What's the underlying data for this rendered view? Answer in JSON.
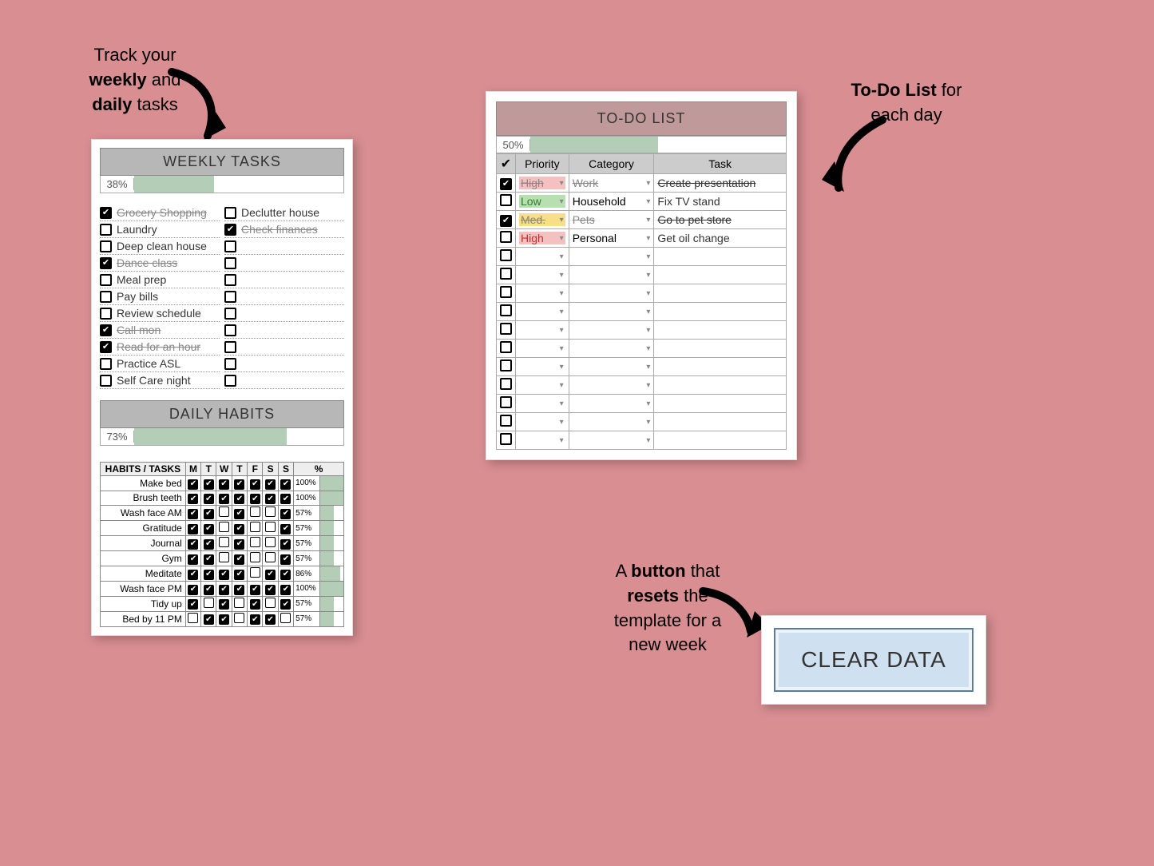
{
  "callouts": {
    "left1": "Track your",
    "left_b1": "weekly",
    "left_mid": " and ",
    "left_b2": "daily",
    "left2": " tasks",
    "right_b": "To-Do List",
    "right_tail": " for each day",
    "clear1": "A ",
    "clear_b1": "button",
    "clear2": " that ",
    "clear_b2": "resets",
    "clear3": " the template for a new week"
  },
  "weekly": {
    "title": "WEEKLY TASKS",
    "percent": "38%",
    "percent_num": 38,
    "left": [
      {
        "done": true,
        "label": "Grocery Shopping"
      },
      {
        "done": false,
        "label": "Laundry"
      },
      {
        "done": false,
        "label": "Deep clean house"
      },
      {
        "done": true,
        "label": "Dance class"
      },
      {
        "done": false,
        "label": "Meal prep"
      },
      {
        "done": false,
        "label": "Pay bills"
      },
      {
        "done": false,
        "label": "Review schedule"
      },
      {
        "done": true,
        "label": "Call mon"
      },
      {
        "done": true,
        "label": "Read for an hour"
      },
      {
        "done": false,
        "label": "Practice ASL"
      },
      {
        "done": false,
        "label": "Self Care night"
      }
    ],
    "right": [
      {
        "done": false,
        "label": "Declutter house"
      },
      {
        "done": true,
        "label": "Check finances"
      },
      {
        "done": false,
        "label": ""
      },
      {
        "done": false,
        "label": ""
      },
      {
        "done": false,
        "label": ""
      },
      {
        "done": false,
        "label": ""
      },
      {
        "done": false,
        "label": ""
      },
      {
        "done": false,
        "label": ""
      },
      {
        "done": false,
        "label": ""
      },
      {
        "done": false,
        "label": ""
      },
      {
        "done": false,
        "label": ""
      }
    ]
  },
  "daily": {
    "title": "DAILY HABITS",
    "percent": "73%",
    "percent_num": 73,
    "days": [
      "M",
      "T",
      "W",
      "T",
      "F",
      "S",
      "S"
    ],
    "cols": {
      "name": "HABITS / TASKS",
      "pct": "%"
    },
    "rows": [
      {
        "name": "Make bed",
        "d": [
          1,
          1,
          1,
          1,
          1,
          1,
          1
        ],
        "pct": "100%",
        "pnum": 100
      },
      {
        "name": "Brush teeth",
        "d": [
          1,
          1,
          1,
          1,
          1,
          1,
          1
        ],
        "pct": "100%",
        "pnum": 100
      },
      {
        "name": "Wash face AM",
        "d": [
          1,
          1,
          0,
          1,
          0,
          0,
          1
        ],
        "pct": "57%",
        "pnum": 57
      },
      {
        "name": "Gratitude",
        "d": [
          1,
          1,
          0,
          1,
          0,
          0,
          1
        ],
        "pct": "57%",
        "pnum": 57
      },
      {
        "name": "Journal",
        "d": [
          1,
          1,
          0,
          1,
          0,
          0,
          1
        ],
        "pct": "57%",
        "pnum": 57
      },
      {
        "name": "Gym",
        "d": [
          1,
          1,
          0,
          1,
          0,
          0,
          1
        ],
        "pct": "57%",
        "pnum": 57
      },
      {
        "name": "Meditate",
        "d": [
          1,
          1,
          1,
          1,
          0,
          1,
          1
        ],
        "pct": "86%",
        "pnum": 86
      },
      {
        "name": "Wash face PM",
        "d": [
          1,
          1,
          1,
          1,
          1,
          1,
          1
        ],
        "pct": "100%",
        "pnum": 100
      },
      {
        "name": "Tidy up",
        "d": [
          1,
          0,
          1,
          0,
          1,
          0,
          1
        ],
        "pct": "57%",
        "pnum": 57
      },
      {
        "name": "Bed by 11 PM",
        "d": [
          0,
          1,
          1,
          0,
          1,
          1,
          0
        ],
        "pct": "57%",
        "pnum": 57
      }
    ]
  },
  "todo": {
    "title": "TO-DO LIST",
    "percent": "50%",
    "percent_num": 50,
    "cols": {
      "check": "✔",
      "prio": "Priority",
      "cat": "Category",
      "task": "Task"
    },
    "rows": [
      {
        "done": true,
        "prio": "High",
        "pcls": "prio-high",
        "cat": "Work",
        "task": "Create presentation"
      },
      {
        "done": false,
        "prio": "Low",
        "pcls": "prio-low",
        "cat": "Household",
        "task": "Fix TV stand"
      },
      {
        "done": true,
        "prio": "Med.",
        "pcls": "prio-med",
        "cat": "Pets",
        "task": "Go to pet store"
      },
      {
        "done": false,
        "prio": "High",
        "pcls": "prio-high",
        "cat": "Personal",
        "task": "Get oil change"
      },
      {
        "done": false,
        "prio": "",
        "pcls": "",
        "cat": "",
        "task": ""
      },
      {
        "done": false,
        "prio": "",
        "pcls": "",
        "cat": "",
        "task": ""
      },
      {
        "done": false,
        "prio": "",
        "pcls": "",
        "cat": "",
        "task": ""
      },
      {
        "done": false,
        "prio": "",
        "pcls": "",
        "cat": "",
        "task": ""
      },
      {
        "done": false,
        "prio": "",
        "pcls": "",
        "cat": "",
        "task": ""
      },
      {
        "done": false,
        "prio": "",
        "pcls": "",
        "cat": "",
        "task": ""
      },
      {
        "done": false,
        "prio": "",
        "pcls": "",
        "cat": "",
        "task": ""
      },
      {
        "done": false,
        "prio": "",
        "pcls": "",
        "cat": "",
        "task": ""
      },
      {
        "done": false,
        "prio": "",
        "pcls": "",
        "cat": "",
        "task": ""
      },
      {
        "done": false,
        "prio": "",
        "pcls": "",
        "cat": "",
        "task": ""
      },
      {
        "done": false,
        "prio": "",
        "pcls": "",
        "cat": "",
        "task": ""
      }
    ]
  },
  "clear": {
    "label": "CLEAR DATA"
  },
  "chart_data": {
    "type": "bar",
    "title": "Daily Habits completion %",
    "categories": [
      "Make bed",
      "Brush teeth",
      "Wash face AM",
      "Gratitude",
      "Journal",
      "Gym",
      "Meditate",
      "Wash face PM",
      "Tidy up",
      "Bed by 11 PM"
    ],
    "values": [
      100,
      100,
      57,
      57,
      57,
      57,
      86,
      100,
      57,
      57
    ],
    "xlabel": "Habit",
    "ylabel": "%",
    "ylim": [
      0,
      100
    ]
  }
}
